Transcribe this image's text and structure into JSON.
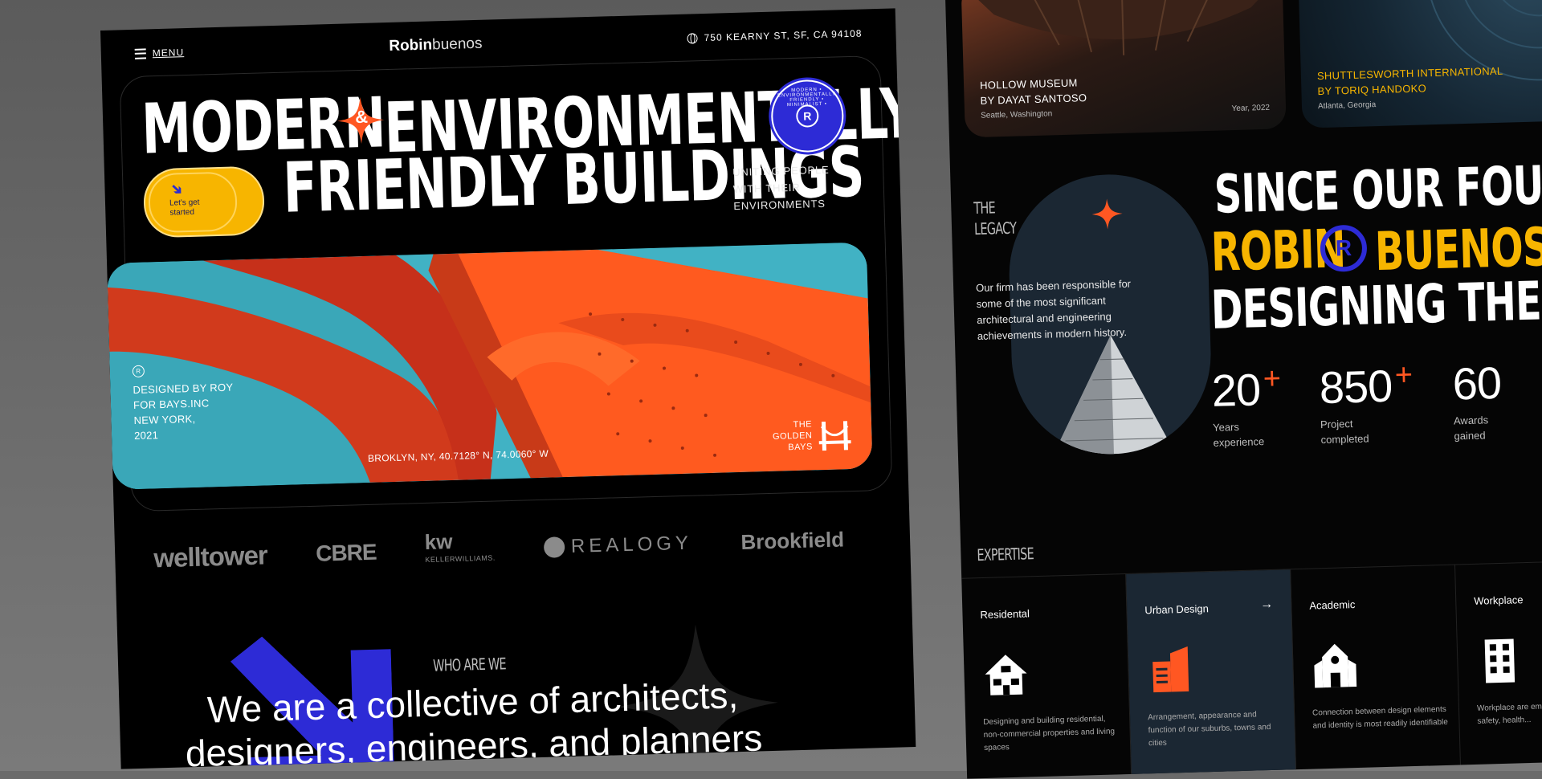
{
  "nav": {
    "menu_label": "MENU",
    "logo_bold": "Robin",
    "logo_light": "buenos",
    "address": "750 KEARNY ST, SF, CA 94108"
  },
  "hero": {
    "line1_a": "MODERN",
    "amp": "&",
    "line1_b": "ENVIRONMENTALLY",
    "line2": "FRIENDLY BUILDINGS",
    "badge_text": "MODERN • ENVIRONMENTALLY FRIENDLY • MINIMALIST •",
    "badge_letter": "R",
    "cta_label": "Let's get started",
    "tagline": "UNITING PEOPLE WITH THEIR ENVIRONMENTS",
    "caption_line1": "DESIGNED BY ROY",
    "caption_line2": "FOR BAYS.INC",
    "caption_line3": "NEW YORK,",
    "caption_line4": "2021",
    "coords": "BROKLYN, NY, 40.7128° N, 74.0060° W",
    "partner_name": "THE GOLDEN BAYS"
  },
  "brands": [
    "welltower",
    "CBRE",
    "kw",
    "KELLERWILLIAMS.",
    "REALOGY",
    "Brookfield"
  ],
  "who": {
    "label": "WHO ARE WE",
    "text": "We are a collective of architects, designers, engineers, and planners"
  },
  "projects": [
    {
      "title1": "HOLLOW MUSEUM",
      "title2": "BY DAYAT SANTOSO",
      "place": "Seattle, Washington",
      "year": "Year, 2022",
      "title_color": "#ffffff"
    },
    {
      "title1": "SHUTTLESWORTH INTERNATIONAL",
      "title2": "BY TORIQ HANDOKO",
      "place": "Atlanta, Georgia",
      "year": "",
      "title_color": "#f7b500"
    }
  ],
  "legacy": {
    "label": "THE LEGACY",
    "paragraph": "Our firm has been responsible for some of the most significant architectural and engineering achievements in modern history.",
    "headline1": "SINCE OUR FOUNDING",
    "headline2a": "ROBIN",
    "headline2b": "BUENOS HA",
    "headline3": "DESIGNING THE FUTUR",
    "logo_letter": "R"
  },
  "stats": [
    {
      "value": "20",
      "suffix": "+",
      "label": "Years experience"
    },
    {
      "value": "850",
      "suffix": "+",
      "label": "Project completed"
    },
    {
      "value": "60",
      "suffix": "",
      "label": "Awards gained"
    }
  ],
  "expertise": {
    "label": "EXPERTISE",
    "items": [
      {
        "title": "Residental",
        "icon": "house-icon",
        "desc": "Designing and building residential, non-commercial properties and living spaces"
      },
      {
        "title": "Urban Design",
        "icon": "urban-building-icon",
        "desc": "Arrangement, appearance and function of our suburbs, towns and cities"
      },
      {
        "title": "Academic",
        "icon": "school-icon",
        "desc": "Connection between design elements and identity is most readily identifiable"
      },
      {
        "title": "Workplace",
        "icon": "office-building-icon",
        "desc": "Workplace are employee perf... safety, health..."
      }
    ],
    "arrow": "→"
  },
  "colors": {
    "accent_orange": "#ff5722",
    "accent_yellow": "#f7b500",
    "accent_blue": "#2d2bd6",
    "panel_bg": "#000000",
    "card_blue": "#1b2733"
  }
}
